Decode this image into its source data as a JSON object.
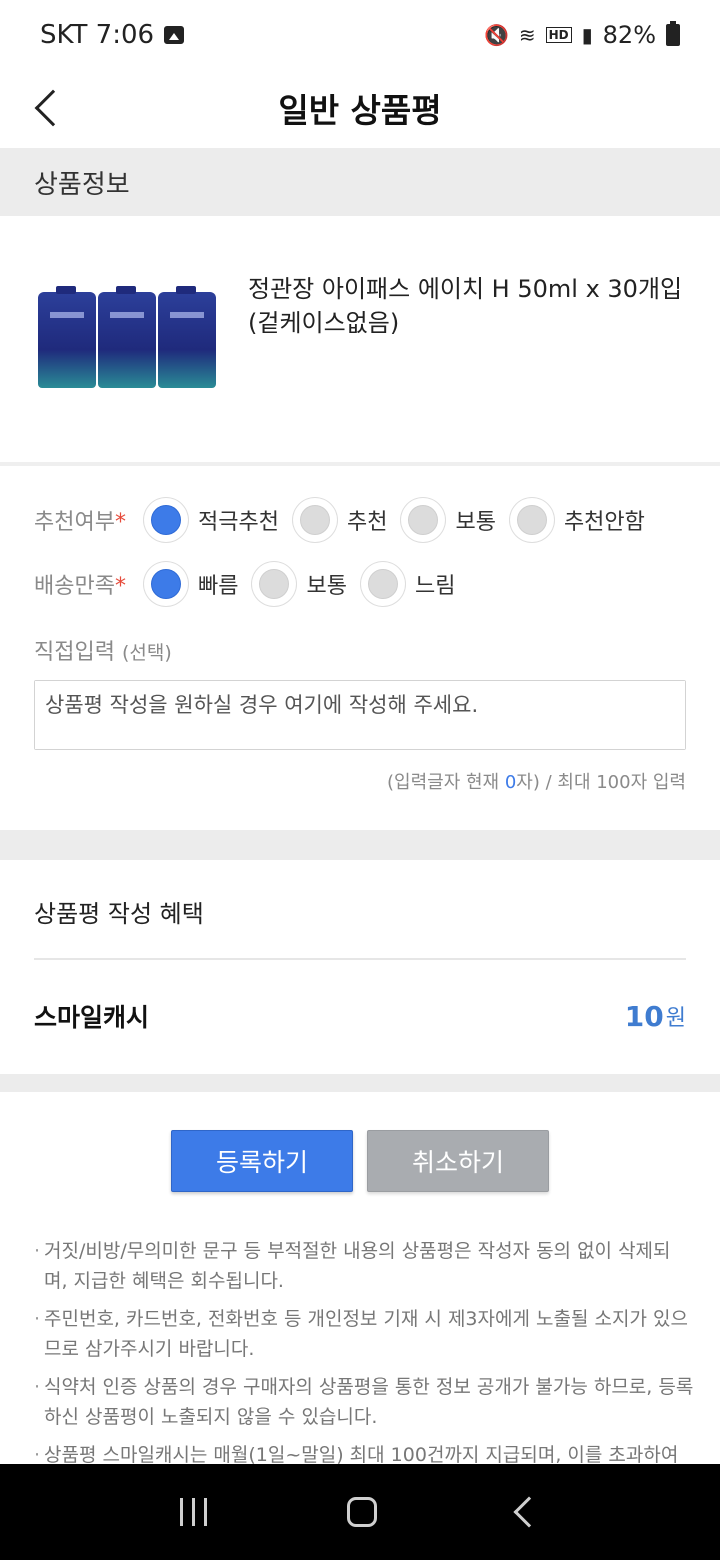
{
  "status_bar": {
    "carrier_time": "SKT 7:06",
    "battery": "82%",
    "icons": [
      "image-icon",
      "mute-icon",
      "wifi-icon",
      "hd-voice-icon",
      "signal-icon",
      "battery-icon"
    ]
  },
  "header": {
    "title": "일반 상품평"
  },
  "product_section": {
    "title": "상품정보",
    "product_name": "정관장 아이패스 에이치 H 50ml x 30개입(겉케이스없음)"
  },
  "recommend": {
    "label": "추천여부",
    "required_mark": "*",
    "options": [
      "적극추천",
      "추천",
      "보통",
      "추천안함"
    ],
    "selected": "적극추천"
  },
  "delivery": {
    "label": "배송만족",
    "required_mark": "*",
    "options": [
      "빠름",
      "보통",
      "느림"
    ],
    "selected": "빠름"
  },
  "review_input": {
    "label": "직접입력",
    "label_optional": "(선택)",
    "placeholder": "상품평 작성을 원하실 경우 여기에 작성해 주세요.",
    "value": "",
    "counter_prefix": "(입력글자 현재 ",
    "counter_current": "0",
    "counter_suffix": "자) / 최대 100자 입력"
  },
  "benefit": {
    "title": "상품평 작성 혜택",
    "name": "스마일캐시",
    "value": "10",
    "unit": "원"
  },
  "buttons": {
    "submit": "등록하기",
    "cancel": "취소하기"
  },
  "notes": [
    "거짓/비방/무의미한 문구 등 부적절한 내용의 상품평은 작성자 동의 없이 삭제되며, 지급한 혜택은 회수됩니다.",
    "주민번호, 카드번호, 전화번호 등 개인정보 기재 시 제3자에게 노출될 소지가 있으므로 삼가주시기 바랍니다.",
    "식약처 인증 상품의 경우 구매자의 상품평을 통한 정보 공개가 불가능 하므로, 등록하신 상품평이 노출되지 않을 수 있습니다.",
    "상품평 스마일캐시는 매월(1일~말일) 최대 100건까지 지급되며, 이를 초과하여"
  ]
}
